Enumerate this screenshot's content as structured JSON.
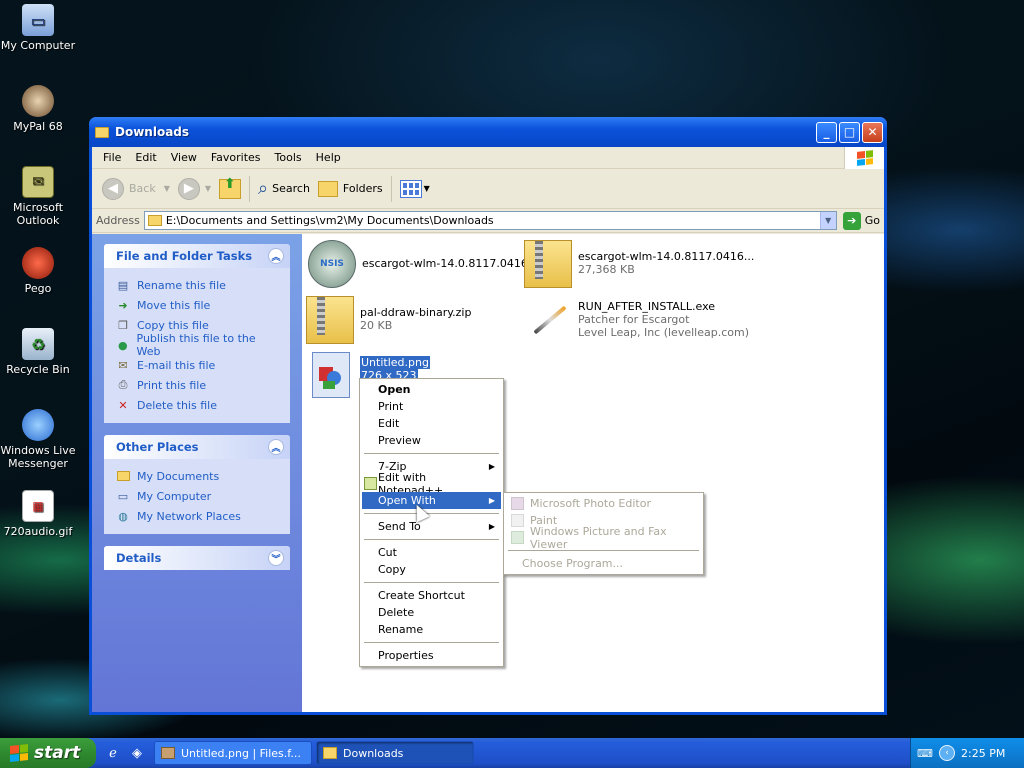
{
  "desktop": {
    "icons": [
      {
        "label": "My Computer",
        "icon": "computer-icon"
      },
      {
        "label": "MyPal 68",
        "icon": "mypal-icon"
      },
      {
        "label": "Microsoft Outlook",
        "icon": "outlook-icon"
      },
      {
        "label": "Pego",
        "icon": "pego-icon"
      },
      {
        "label": "Recycle Bin",
        "icon": "recycle-bin-icon"
      },
      {
        "label": "Windows Live Messenger",
        "icon": "messenger-icon"
      },
      {
        "label": "720audio.gif",
        "icon": "gif-file-icon"
      }
    ]
  },
  "window": {
    "title": "Downloads",
    "menu": [
      "File",
      "Edit",
      "View",
      "Favorites",
      "Tools",
      "Help"
    ],
    "toolbar": {
      "back": "Back",
      "search": "Search",
      "folders": "Folders"
    },
    "address": {
      "label": "Address",
      "value": "E:\\Documents and Settings\\vm2\\My Documents\\Downloads",
      "go": "Go"
    },
    "tasks": {
      "file_folder": {
        "title": "File and Folder Tasks",
        "items": [
          "Rename this file",
          "Move this file",
          "Copy this file",
          "Publish this file to the Web",
          "E-mail this file",
          "Print this file",
          "Delete this file"
        ]
      },
      "other_places": {
        "title": "Other Places",
        "items": [
          "My Documents",
          "My Computer",
          "My Network Places"
        ]
      },
      "details": {
        "title": "Details"
      }
    },
    "files": [
      {
        "name": "escargot-wlm-14.0.8117.0416...",
        "sub1": "",
        "sub2": ""
      },
      {
        "name": "escargot-wlm-14.0.8117.0416...",
        "sub1": "27,368 KB",
        "sub2": ""
      },
      {
        "name": "pal-ddraw-binary.zip",
        "sub1": "20 KB",
        "sub2": ""
      },
      {
        "name": "RUN_AFTER_INSTALL.exe",
        "sub1": "Patcher for Escargot",
        "sub2": "Level Leap, Inc (levelleap.com)"
      },
      {
        "name": "Untitled.png",
        "sub1": "726 x 523",
        "sub2": ""
      }
    ]
  },
  "context_menu": {
    "items": [
      "Open",
      "Print",
      "Edit",
      "Preview",
      "7-Zip",
      "Edit with Notepad++",
      "Open With",
      "Send To",
      "Cut",
      "Copy",
      "Create Shortcut",
      "Delete",
      "Rename",
      "Properties"
    ]
  },
  "open_with_menu": {
    "items": [
      "Microsoft Photo Editor",
      "Paint",
      "Windows Picture and Fax Viewer",
      "Choose Program..."
    ]
  },
  "taskbar": {
    "start": "start",
    "tasks": [
      "Untitled.png | Files.f...",
      "Downloads"
    ],
    "clock": "2:25 PM"
  },
  "colors": {
    "selection": "#316ac5",
    "link": "#215dc6",
    "taskbar": "#245ddb",
    "start": "#2f8a2f"
  }
}
